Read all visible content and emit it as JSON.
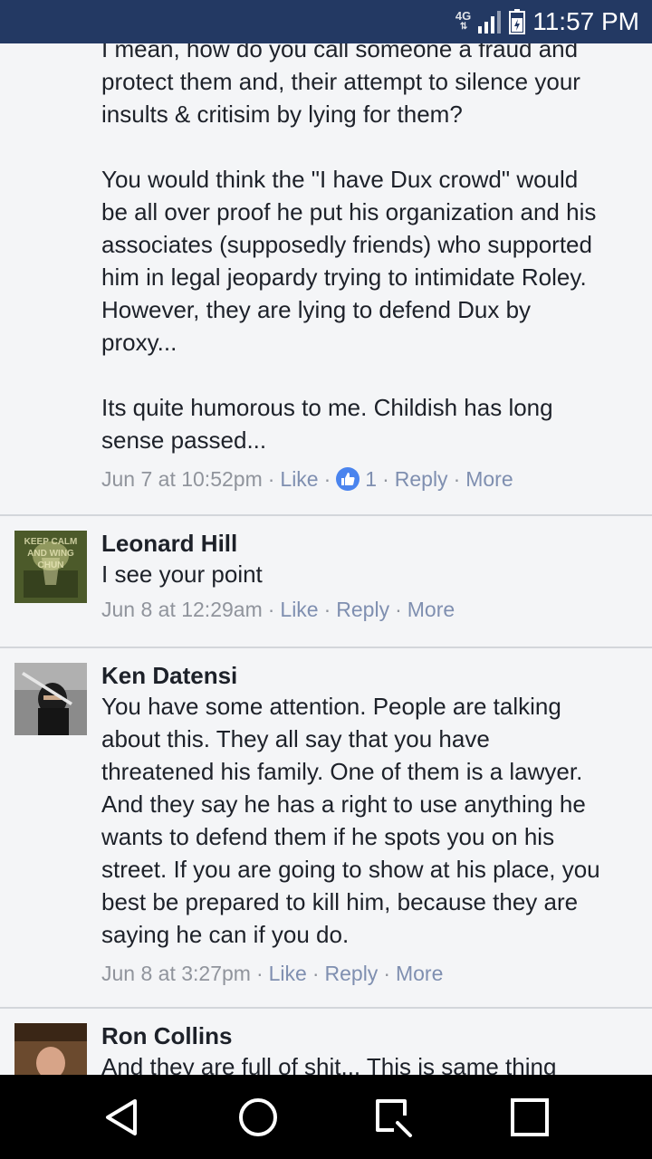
{
  "status_bar": {
    "network": "4G",
    "time": "11:57 PM"
  },
  "comments": [
    {
      "author": "",
      "text": "I mean, how do you call someone a fraud and\nprotect them and, their attempt to silence your\ninsults & critisim by lying for them?\n\nYou would think the \"I have Dux crowd\" would\nbe all over proof he put his organization and his\nassociates (supposedly friends) who supported\nhim in legal jeopardy trying to intimidate Roley.\nHowever, they are lying to defend Dux by\nproxy...\n\nIts quite humorous to me. Childish has long\nsense passed...",
      "time": "Jun 7 at 10:52pm",
      "like_label": "Like",
      "like_count": "1",
      "reply_label": "Reply",
      "more_label": "More"
    },
    {
      "author": "Leonard Hill",
      "avatar_text": "KEEP CALM AND WING CHUN",
      "text": "I see your point",
      "time": "Jun 8 at 12:29am",
      "like_label": "Like",
      "reply_label": "Reply",
      "more_label": "More"
    },
    {
      "author": "Ken Datensi",
      "text": "You have some attention. People are talking\nabout this. They all say that you have\nthreatened his family. One of them is a lawyer.\nAnd they say he has a right to use anything he\nwants to defend them if he spots you on his\nstreet. If you are going to show at his place, you\nbest be prepared to kill him, because they are\nsaying he can if you do.",
      "time": "Jun 8 at 3:27pm",
      "like_label": "Like",
      "reply_label": "Reply",
      "more_label": "More"
    },
    {
      "author": "Ron Collins",
      "text": "And they are full of shit... This is same thing"
    }
  ],
  "colors": {
    "status_bar": "#233963",
    "link": "#7f8fb0",
    "meta": "#90949c",
    "like_badge": "#4a84ee",
    "background": "#f4f5f7"
  },
  "nav_bar": {
    "icons": [
      "back-icon",
      "home-icon",
      "recents-icon",
      "square-icon"
    ]
  }
}
